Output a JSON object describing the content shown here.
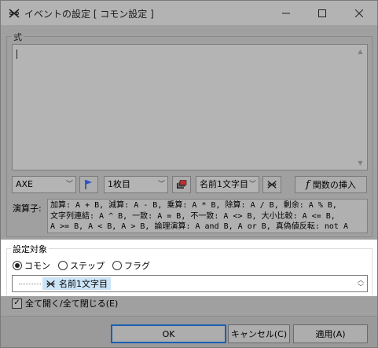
{
  "window": {
    "title": "イベントの設定 [ コモン設定 ]",
    "icon": "event-settings-icon"
  },
  "expression": {
    "group_label": "式",
    "text": ""
  },
  "toolbar": {
    "combo1_value": "AXE",
    "flag_icon": "flag-icon",
    "combo2_value": "1枚目",
    "page_icon": "layers-icon",
    "combo3_value": "名前1文字目",
    "swap_icon": "x-event-icon",
    "insert_function_label": "関数の挿入"
  },
  "operators": {
    "label": "演算子:",
    "lines": [
      "加算: A + B, 減算: A - B, 乗算: A * B, 除算: A / B, 剰余: A % B,",
      "文字列連結: A ^ B, 一致: A = B, 不一致: A <> B, 大小比較: A <= B,",
      "A >= B, A < B, A > B, 論理演算: A and B, A or B, 真偽値反転: not A"
    ]
  },
  "target": {
    "group_label": "設定対象",
    "options": [
      {
        "label": "コモン",
        "selected": true
      },
      {
        "label": "ステップ",
        "selected": false
      },
      {
        "label": "フラグ",
        "selected": false
      }
    ],
    "selected_item": "名前1文字目"
  },
  "expand_all": {
    "label": "全て開く/全て閉じる(E)",
    "checked": true
  },
  "buttons": {
    "ok": "OK",
    "cancel": "キャンセル(C)",
    "apply": "適用(A)"
  }
}
